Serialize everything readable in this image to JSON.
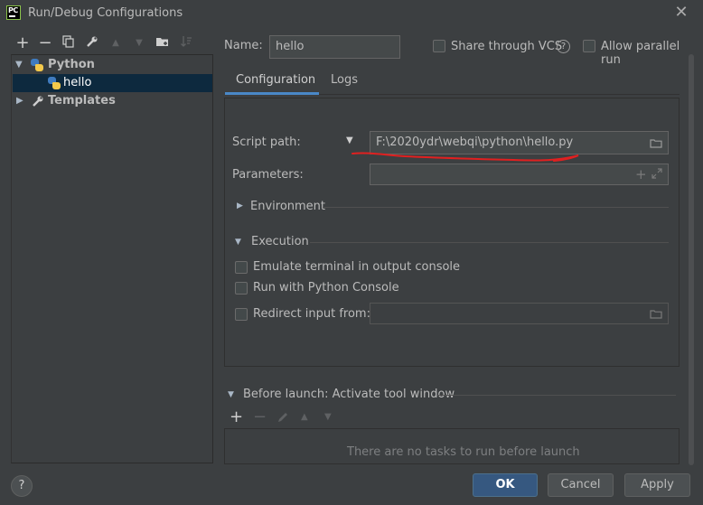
{
  "window": {
    "title": "Run/Debug Configurations",
    "app_icon_text": "PC"
  },
  "left_toolbar": {
    "icons": [
      "add-icon",
      "remove-icon",
      "copy-icon",
      "wrench-icon",
      "move-up-icon",
      "move-down-icon",
      "new-folder-icon",
      "sort-icon"
    ]
  },
  "tree": {
    "items": [
      {
        "label": "Python",
        "expanded": true
      },
      {
        "label": "hello",
        "selected": true
      },
      {
        "label": "Templates",
        "expanded": false
      }
    ]
  },
  "name_row": {
    "label": "Name:",
    "value": "hello",
    "share_label": "Share through VCS",
    "help_symbol": "?",
    "parallel_label": "Allow parallel run"
  },
  "tabs": [
    {
      "label": "Configuration",
      "active": true
    },
    {
      "label": "Logs",
      "active": false
    }
  ],
  "config": {
    "script_path_label": "Script path:",
    "script_path_value": "F:\\2020ydr\\webqi\\python\\hello.py",
    "parameters_label": "Parameters:",
    "parameters_value": "",
    "environment_label": "Environment",
    "execution_label": "Execution",
    "emulate_terminal_label": "Emulate terminal in output console",
    "run_python_console_label": "Run with Python Console",
    "redirect_input_label": "Redirect input from:",
    "redirect_input_value": ""
  },
  "before_launch": {
    "title": "Before launch: Activate tool window",
    "empty_message": "There are no tasks to run before launch"
  },
  "footer": {
    "help_label": "?",
    "ok_label": "OK",
    "cancel_label": "Cancel",
    "apply_label": "Apply"
  },
  "colors": {
    "background": "#3c3f41",
    "selection": "#0d293e",
    "accent": "#4a88c7",
    "primary_button": "#365880",
    "annotation_red": "#e02020"
  }
}
